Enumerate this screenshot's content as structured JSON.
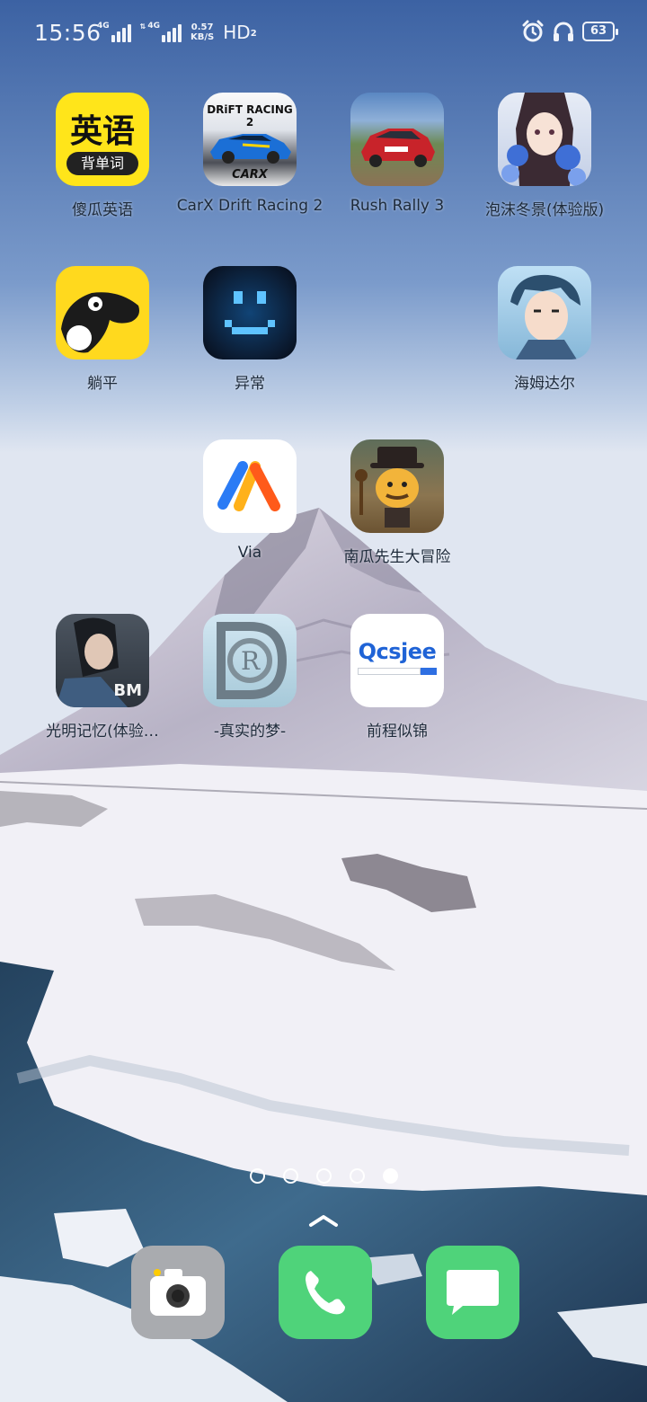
{
  "status_bar": {
    "time": "15:56",
    "network_1": "4G",
    "network_2": "4G",
    "speed_value": "0.57",
    "speed_unit": "KB/S",
    "hd_label": "HD",
    "hd_sub": "2",
    "battery": "63"
  },
  "apps": [
    {
      "label": "傻瓜英语",
      "icon_text_top": "英语",
      "icon_text_bottom": "背单词",
      "icon": "english-vocab-icon"
    },
    {
      "label": "CarX Drift Racing 2",
      "icon_text_top": "DRiFT RACING 2",
      "icon_text_bottom": "CARX",
      "icon": "carx-drift-racing-icon"
    },
    {
      "label": "Rush Rally 3",
      "icon": "rush-rally-car-icon"
    },
    {
      "label": "泡沫冬景(体验版)",
      "icon": "anime-girl-roses-icon"
    },
    {
      "label": "躺平",
      "icon": "lying-flat-bird-icon"
    },
    {
      "label": "异常",
      "icon": "pixel-smiley-icon"
    },
    {
      "label": "海姆达尔",
      "icon": "anime-boy-icon"
    },
    {
      "label": "Via",
      "icon": "via-browser-icon"
    },
    {
      "label": "南瓜先生大冒险",
      "icon": "mr-pumpkin-icon"
    },
    {
      "label": "光明记忆(体验…",
      "icon": "bright-memory-icon",
      "icon_text": "BM"
    },
    {
      "label": "-真实的梦-",
      "icon": "true-dream-logo-icon"
    },
    {
      "label": "前程似锦",
      "icon": "qcsjee-icon",
      "icon_text": "Qcsjee"
    }
  ],
  "page_indicator": {
    "count": 5,
    "active": 5
  },
  "dock": [
    {
      "name": "camera",
      "icon": "camera-icon"
    },
    {
      "name": "phone",
      "icon": "phone-icon"
    },
    {
      "name": "messages",
      "icon": "message-icon"
    }
  ],
  "colors": {
    "dock_green": "#4fd37a",
    "camera_gray": "#a7a9ad",
    "english_yellow": "#ffe51a",
    "via_orange": "#ff6a00",
    "via_blue": "#2a7bf5"
  }
}
